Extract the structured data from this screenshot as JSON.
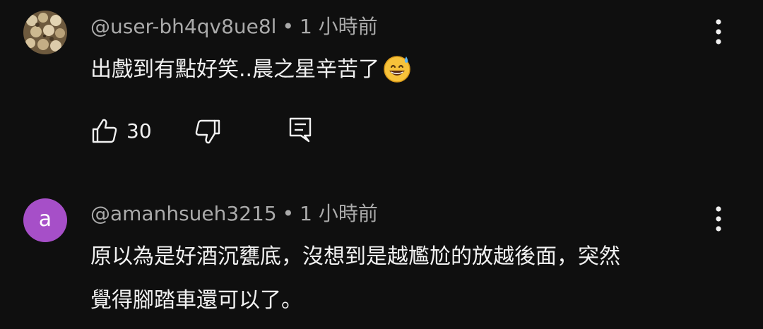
{
  "comments": [
    {
      "author": "@user-bh4qv8ue8l",
      "separator": "•",
      "time": "1 小時前",
      "text": "出戲到有點好笑..晨之星辛苦了",
      "emoji": "grinning-face-with-sweat",
      "like_count": "30",
      "avatar": "photo"
    },
    {
      "author": "@amanhsueh3215",
      "separator": "•",
      "time": "1 小時前",
      "text_line1": "原以為是好酒沉甕底，沒想到是越尷尬的放越後面，突然",
      "text_line2": "覺得腳踏車還可以了。",
      "avatar_letter": "a",
      "avatar_color": "#a64fc8"
    }
  ],
  "icons": {
    "like": "thumb-up-icon",
    "dislike": "thumb-down-icon",
    "reply": "reply-icon",
    "menu": "more-vert-icon"
  }
}
